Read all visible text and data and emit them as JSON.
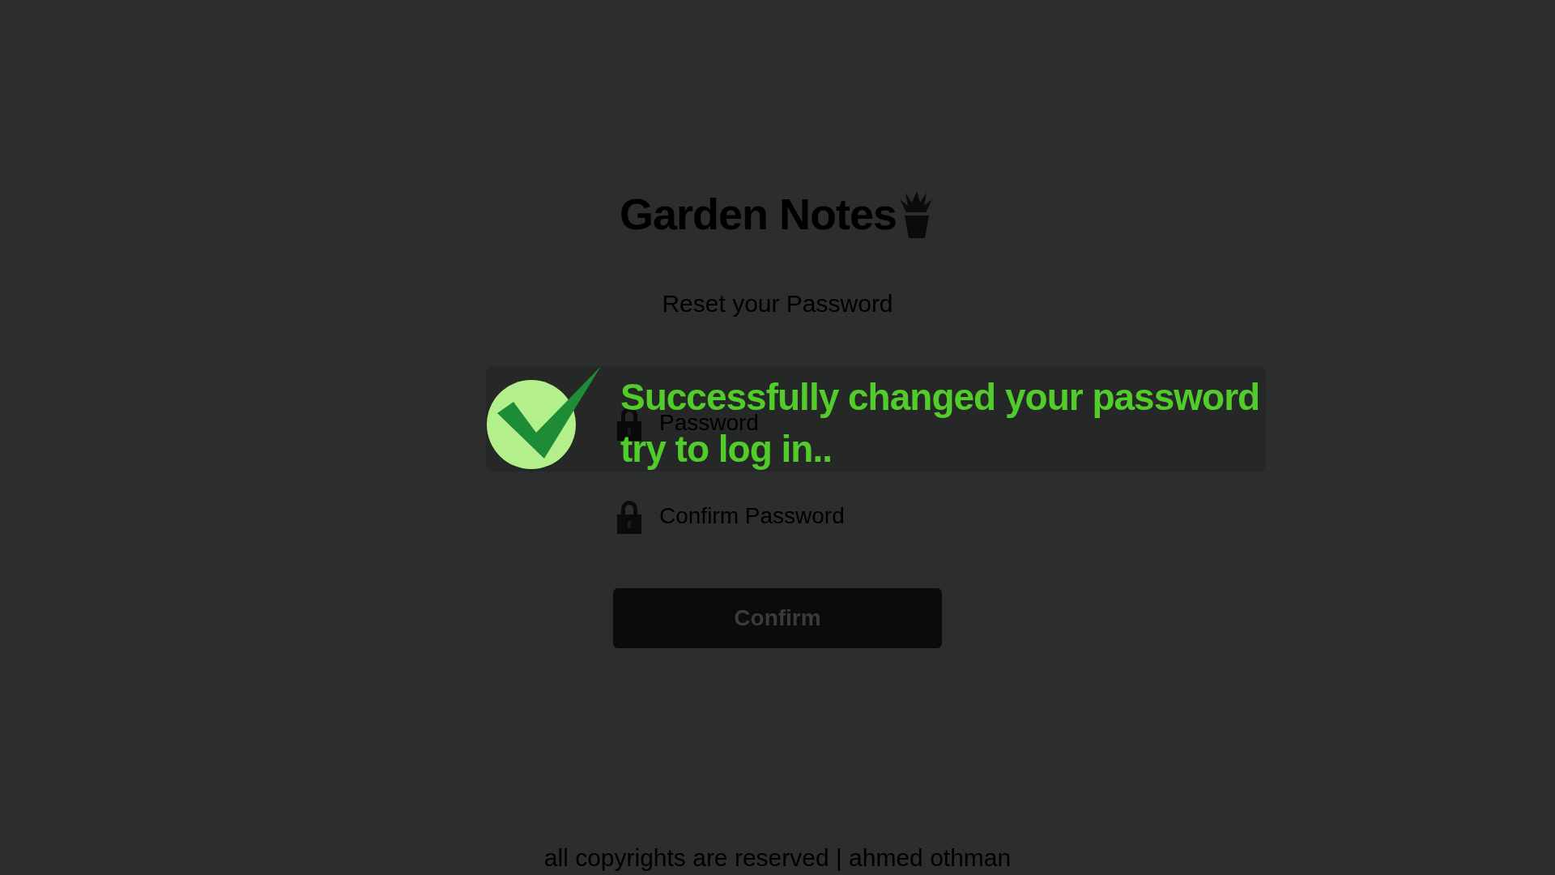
{
  "app": {
    "title": "Garden Notes"
  },
  "form": {
    "heading": "Reset your Password",
    "fields": [
      {
        "kind": "password",
        "placeholder": "Password"
      },
      {
        "kind": "password",
        "placeholder": "Confirm Password"
      }
    ],
    "submit": "Confirm"
  },
  "footer": "all copyrights are reserved | ahmed othman",
  "alert": {
    "kind": "success",
    "lines": [
      "Successfully changed your password",
      "try to log in.."
    ]
  }
}
